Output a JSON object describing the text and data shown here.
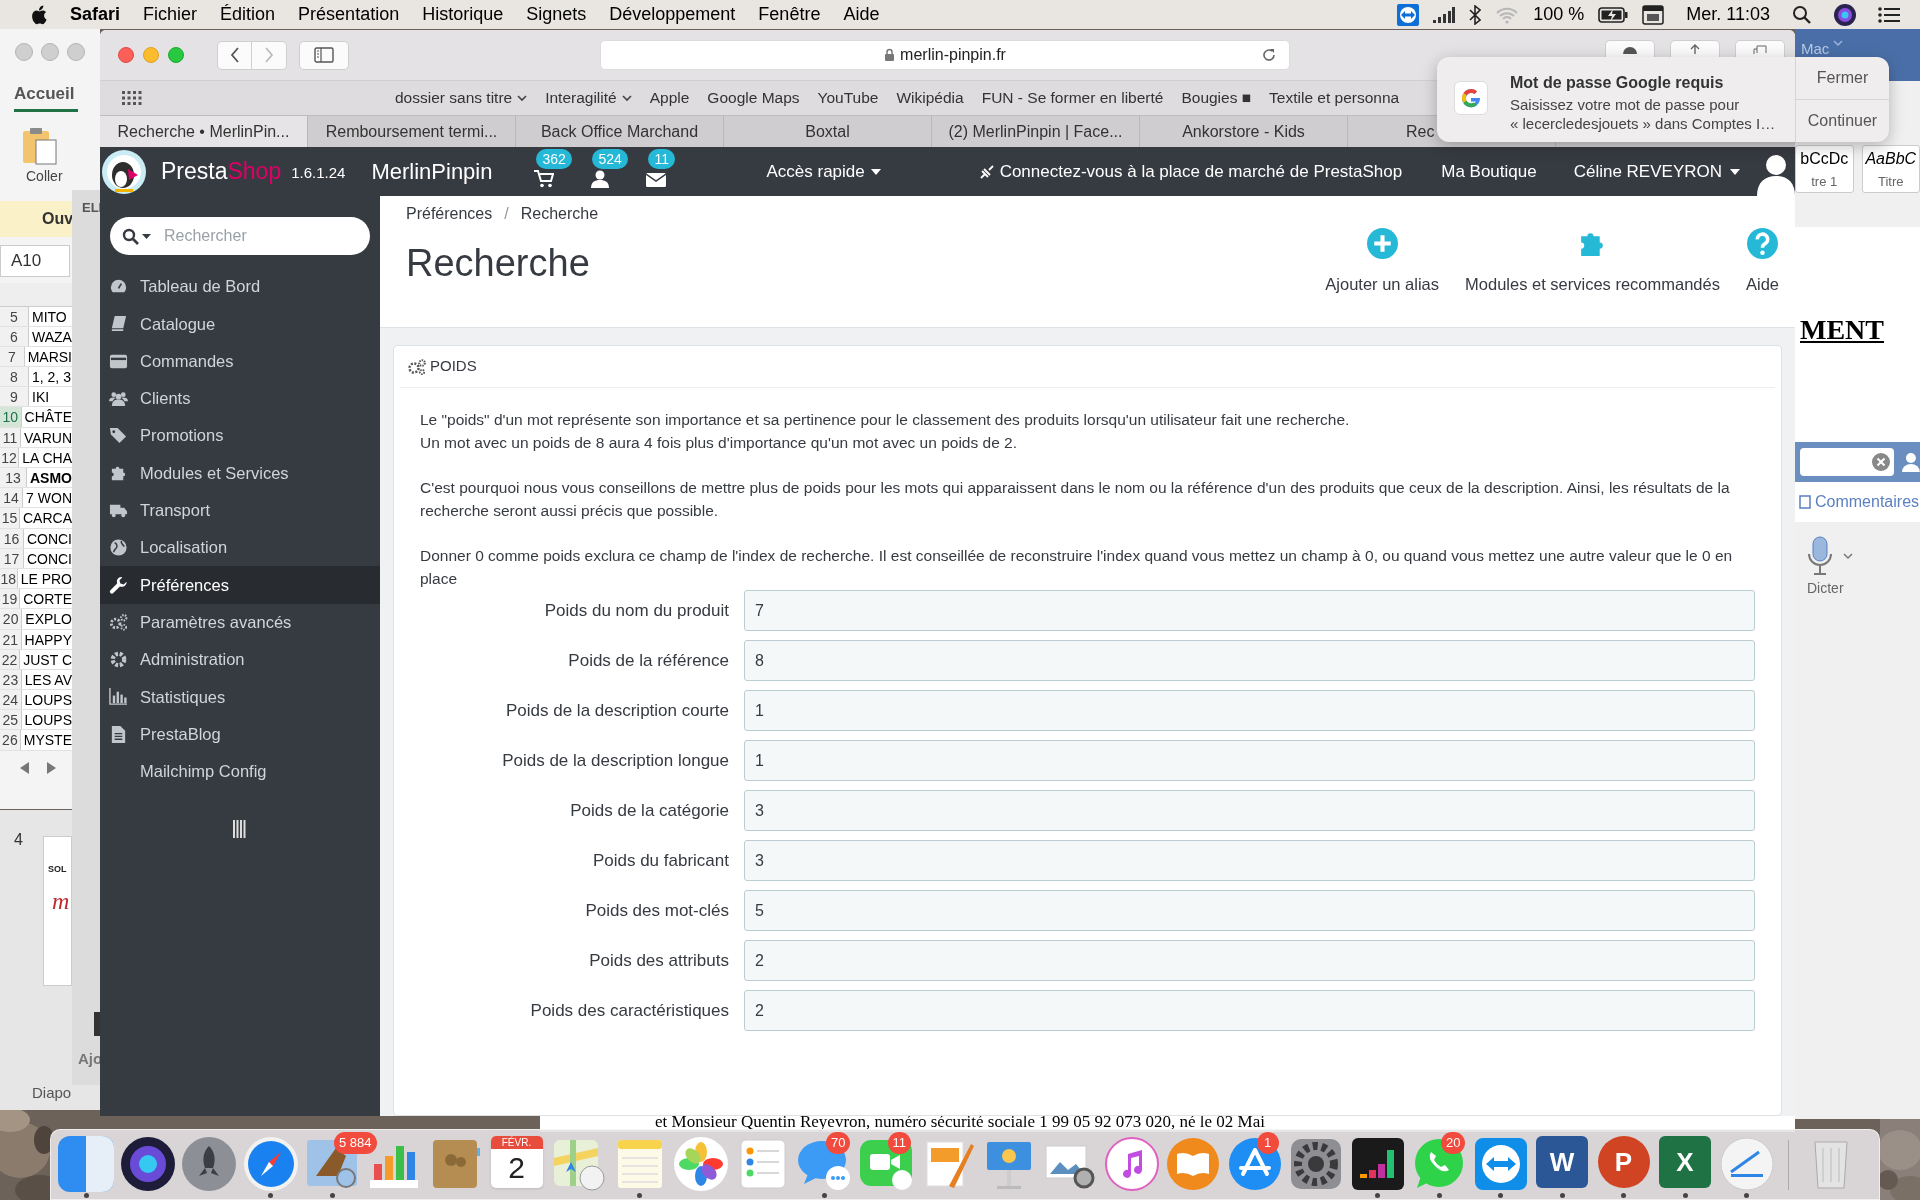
{
  "menu_bar": {
    "app": "Safari",
    "menus": [
      "Fichier",
      "Édition",
      "Présentation",
      "Historique",
      "Signets",
      "Développement",
      "Fenêtre",
      "Aide"
    ],
    "battery": "100 %",
    "clock": "Mer. 11:03"
  },
  "excel_window": {
    "tab": "Accueil",
    "paste_label": "Coller",
    "banner": "Ouv",
    "name_box": "A10",
    "side_label": "ELI",
    "rows": [
      {
        "number": "5",
        "text": "MITO",
        "selected": false,
        "bold": false
      },
      {
        "number": "6",
        "text": "WAZA",
        "selected": false,
        "bold": false
      },
      {
        "number": "7",
        "text": "MARSI",
        "selected": false,
        "bold": false
      },
      {
        "number": "8",
        "text": "1, 2, 3",
        "selected": false,
        "bold": false
      },
      {
        "number": "9",
        "text": "IKI",
        "selected": false,
        "bold": false
      },
      {
        "number": "10",
        "text": "CHÂTE",
        "selected": true,
        "bold": false
      },
      {
        "number": "11",
        "text": "VARUN",
        "selected": false,
        "bold": false
      },
      {
        "number": "12",
        "text": "LA CHA",
        "selected": false,
        "bold": false
      },
      {
        "number": "13",
        "text": "ASMO",
        "selected": false,
        "bold": true
      },
      {
        "number": "14",
        "text": "7 WON",
        "selected": false,
        "bold": false
      },
      {
        "number": "15",
        "text": "CARCA",
        "selected": false,
        "bold": false
      },
      {
        "number": "16",
        "text": "CONCI",
        "selected": false,
        "bold": false
      },
      {
        "number": "17",
        "text": "CONCI",
        "selected": false,
        "bold": false
      },
      {
        "number": "18",
        "text": "LE PRO",
        "selected": false,
        "bold": false
      },
      {
        "number": "19",
        "text": "CORTE",
        "selected": false,
        "bold": false
      },
      {
        "number": "20",
        "text": "EXPLO",
        "selected": false,
        "bold": false
      },
      {
        "number": "21",
        "text": "HAPPY",
        "selected": false,
        "bold": false
      },
      {
        "number": "22",
        "text": "JUST C",
        "selected": false,
        "bold": false
      },
      {
        "number": "23",
        "text": "LES AV",
        "selected": false,
        "bold": false
      },
      {
        "number": "24",
        "text": "LOUPS",
        "selected": false,
        "bold": false
      },
      {
        "number": "25",
        "text": "LOUPS",
        "selected": false,
        "bold": false
      },
      {
        "number": "26",
        "text": "MYSTE",
        "selected": false,
        "bold": false
      }
    ]
  },
  "slides_window": {
    "slide_number": "4",
    "slide_text": "SOL",
    "slide_logo": "m",
    "add_label": "Ajo",
    "footer": "Diapo"
  },
  "word_window": {
    "account": "Mac",
    "styles": [
      {
        "sample": "bCcDc",
        "name": "tre 1",
        "italic": false
      },
      {
        "sample": "AaBbC",
        "name": "Titre",
        "italic": true
      }
    ],
    "heading": "MENT",
    "comments": "Commentaires",
    "dictate": "Dicter",
    "body_line": "et Monsieur Quentin Reyevron, numéro sécurité sociale 1 99 05 92 073 020, né le 02 Mai"
  },
  "safari": {
    "url": "merlin-pinpin.fr",
    "bookmarks": [
      {
        "label": "dossier sans titre",
        "menu": true
      },
      {
        "label": "Interagilité",
        "menu": true
      },
      {
        "label": "Apple",
        "menu": false
      },
      {
        "label": "Google Maps",
        "menu": false
      },
      {
        "label": "YouTube",
        "menu": false
      },
      {
        "label": "Wikipédia",
        "menu": false
      },
      {
        "label": "FUN - Se former en liberté",
        "menu": false
      },
      {
        "label": "Bougies ■",
        "menu": false
      },
      {
        "label": "Textile et personna",
        "menu": false
      }
    ],
    "tabs": [
      {
        "label": "Recherche • MerlinPin...",
        "selected": true
      },
      {
        "label": "Remboursement termi...",
        "selected": false
      },
      {
        "label": "Back Office Marchand",
        "selected": false
      },
      {
        "label": "Boxtal",
        "selected": false
      },
      {
        "label": "(2) MerlinPinpin | Face...",
        "selected": false
      },
      {
        "label": "Ankorstore - Kids",
        "selected": false
      },
      {
        "label": "Rec",
        "selected": false
      }
    ]
  },
  "notification": {
    "title": "Mot de passe Google requis",
    "lines": [
      "Saisissez votre mot de passe pour",
      "« lecercledesjouets » dans Comptes I…"
    ],
    "actions": [
      "Fermer",
      "Continuer"
    ]
  },
  "header": {
    "brand": [
      "Presta",
      "Shop"
    ],
    "version": "1.6.1.24",
    "shop": "MerlinPinpin",
    "counters": [
      {
        "kind": "cart",
        "count": "362"
      },
      {
        "kind": "customer",
        "count": "524"
      },
      {
        "kind": "message",
        "count": "11"
      }
    ],
    "quick_access": "Accès rapide",
    "marketplace": "Connectez-vous à la place de marché de PrestaShop",
    "shop_link": "Ma Boutique",
    "user": "Céline REVEYRON"
  },
  "sidebar": {
    "search_placeholder": "Rechercher",
    "items": [
      {
        "label": "Tableau de Bord",
        "selected": false
      },
      {
        "label": "Catalogue",
        "selected": false
      },
      {
        "label": "Commandes",
        "selected": false
      },
      {
        "label": "Clients",
        "selected": false
      },
      {
        "label": "Promotions",
        "selected": false
      },
      {
        "label": "Modules et Services",
        "selected": false
      },
      {
        "label": "Transport",
        "selected": false
      },
      {
        "label": "Localisation",
        "selected": false
      },
      {
        "label": "Préférences",
        "selected": true
      },
      {
        "label": "Paramètres avancés",
        "selected": false
      },
      {
        "label": "Administration",
        "selected": false
      },
      {
        "label": "Statistiques",
        "selected": false
      },
      {
        "label": "PrestaBlog",
        "selected": false
      },
      {
        "label": "Mailchimp Config",
        "selected": false
      }
    ]
  },
  "page": {
    "breadcrumb": [
      "Préférences",
      "Recherche"
    ],
    "breadcrumb_separator": "/",
    "title": "Recherche",
    "actions": [
      {
        "kind": "add",
        "label": "Ajouter un alias"
      },
      {
        "kind": "modules",
        "label": "Modules et services recommandés"
      },
      {
        "kind": "help",
        "label": "Aide"
      }
    ],
    "panel": {
      "heading": "POIDS",
      "paragraphs": [
        [
          "Le \"poids\" d'un mot représente son importance et sa pertinence pour le classement des produits lorsqu'un utilisateur fait une recherche.",
          "Un mot avec un poids de 8 aura 4 fois plus d'importance qu'un mot avec un poids de 2."
        ],
        [
          "C'est pourquoi nous vous conseillons de mettre plus de poids pour les mots qui apparaissent dans le nom ou la référence d'un des produits que ceux de la description. Ainsi, les résultats de la recherche seront aussi précis que possible."
        ],
        [
          "Donner 0 comme poids exclura ce champ de l'index de recherche. Il est conseillée de reconstruire l'index quand vous mettez un champ à 0, ou quand vous mettez une autre valeur que le 0 en place"
        ]
      ],
      "fields": [
        {
          "label": "Poids du nom du produit",
          "value": "7"
        },
        {
          "label": "Poids de la référence",
          "value": "8"
        },
        {
          "label": "Poids de la description courte",
          "value": "1"
        },
        {
          "label": "Poids de la description longue",
          "value": "1"
        },
        {
          "label": "Poids de la catégorie",
          "value": "3"
        },
        {
          "label": "Poids du fabricant",
          "value": "3"
        },
        {
          "label": "Poids des mot-clés",
          "value": "5"
        },
        {
          "label": "Poids des attributs",
          "value": "2"
        },
        {
          "label": "Poids des caractéristiques",
          "value": "2"
        }
      ]
    }
  },
  "dock": [
    {
      "kind": "finder",
      "running": true
    },
    {
      "kind": "siri",
      "running": false
    },
    {
      "kind": "launchpad",
      "running": false
    },
    {
      "kind": "safari",
      "running": true
    },
    {
      "kind": "mail",
      "running": true,
      "badge": "5 884"
    },
    {
      "kind": "numbers",
      "running": false
    },
    {
      "kind": "contacts",
      "running": false
    },
    {
      "kind": "calendar",
      "running": false,
      "month": "FÉVR.",
      "day": "2"
    },
    {
      "kind": "maps",
      "running": false
    },
    {
      "kind": "notes",
      "running": true
    },
    {
      "kind": "photos",
      "running": false
    },
    {
      "kind": "reminders",
      "running": false
    },
    {
      "kind": "messages",
      "running": true,
      "badge": "70"
    },
    {
      "kind": "facetime",
      "running": false,
      "badge": "11"
    },
    {
      "kind": "pages",
      "running": false
    },
    {
      "kind": "keynote",
      "running": false
    },
    {
      "kind": "preview",
      "running": false
    },
    {
      "kind": "itunes",
      "running": false
    },
    {
      "kind": "books",
      "running": false
    },
    {
      "kind": "appstore",
      "running": false,
      "badge": "1"
    },
    {
      "kind": "syspref",
      "running": false
    },
    {
      "kind": "deezer",
      "running": true
    },
    {
      "kind": "whatsapp",
      "running": true,
      "badge": "20"
    },
    {
      "kind": "teamviewer",
      "running": true
    },
    {
      "kind": "word",
      "running": true,
      "letter": "W"
    },
    {
      "kind": "powerpoint",
      "running": true,
      "letter": "P"
    },
    {
      "kind": "excel",
      "running": true,
      "letter": "X"
    },
    {
      "kind": "scan",
      "running": true
    },
    {
      "kind": "trash",
      "running": false
    }
  ]
}
